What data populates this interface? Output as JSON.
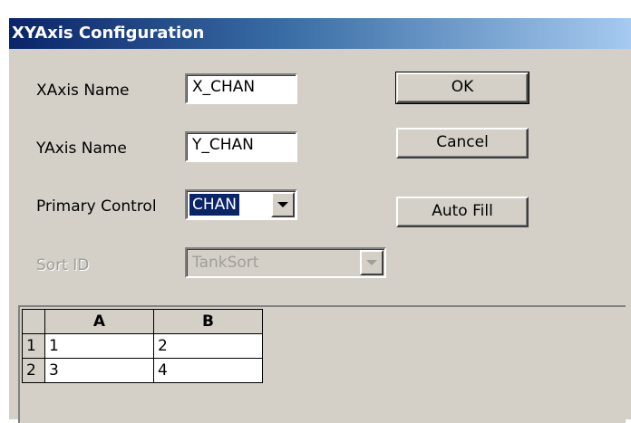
{
  "window": {
    "title": "XYAxis Configuration"
  },
  "form": {
    "xaxis_label": "XAxis Name",
    "xaxis_value": "X_CHAN",
    "yaxis_label": "YAxis Name",
    "yaxis_value": "Y_CHAN",
    "primary_label": "Primary Control",
    "primary_value": "CHAN",
    "sort_label": "Sort ID",
    "sort_value": "TankSort"
  },
  "buttons": {
    "ok": "OK",
    "cancel": "Cancel",
    "auto_fill": "Auto Fill"
  },
  "grid": {
    "columns": [
      "A",
      "B"
    ],
    "rows": [
      {
        "header": "1",
        "cells": [
          "1",
          "2"
        ]
      },
      {
        "header": "2",
        "cells": [
          "3",
          "4"
        ]
      }
    ]
  }
}
